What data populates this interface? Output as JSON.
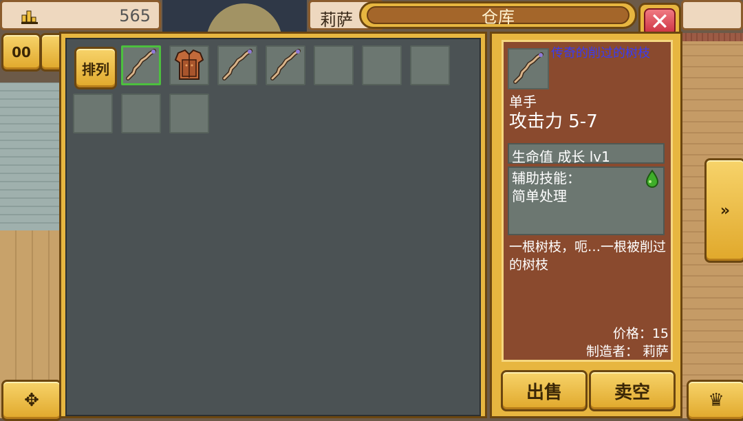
{
  "top_bar": {
    "money_amount": "565",
    "character_tab_label": "莉萨",
    "title": "仓库",
    "close_label": "✕"
  },
  "left_buttons": {
    "top_glyph": "00",
    "bottom_glyph": "✥"
  },
  "storage": {
    "sort_label": "排列",
    "slots": [
      {
        "item": "stick",
        "selected": true
      },
      {
        "item": "armor",
        "selected": false
      },
      {
        "item": "stick",
        "selected": false
      },
      {
        "item": "stick",
        "selected": false
      },
      {
        "item": "",
        "selected": false
      },
      {
        "item": "",
        "selected": false
      },
      {
        "item": "",
        "selected": false
      },
      {
        "item": "",
        "selected": false
      },
      {
        "item": "",
        "selected": false
      },
      {
        "item": "",
        "selected": false
      }
    ]
  },
  "detail": {
    "item_name": "传奇的削过的树枝",
    "hand_type": "单手",
    "attack": "攻击力 5-7",
    "growth": "生命值 成长 lv1",
    "support_skill_label": "辅助技能：",
    "support_skill_value": "简单处理",
    "description": "一根树枝，呃…一根被削过的树枝",
    "price": "价格：15",
    "maker": "制造者： 莉萨"
  },
  "actions": {
    "sell_label": "出售",
    "sell_all_label": "卖空"
  },
  "right_buttons": {
    "next_glyph": "»",
    "crown_glyph": "♛"
  },
  "colors": {
    "gold": "#e7b640",
    "panel": "#4b5254",
    "detail_bg": "#8a4a2e",
    "item_name": "#3a3cf0",
    "selected_border": "#4cc03e"
  }
}
